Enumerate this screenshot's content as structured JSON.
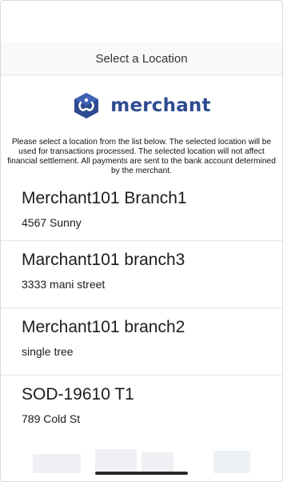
{
  "header": {
    "title": "Select a Location"
  },
  "logo": {
    "text": "merchant",
    "brand_color": "#2f4a8f"
  },
  "instructions": "Please select a location from the list below. The selected location will be used for transactions processed. The selected location will not affect financial settlement. All payments are sent to the bank account determined by the merchant.",
  "locations": [
    {
      "name": "Merchant101 Branch1",
      "address": "4567 Sunny"
    },
    {
      "name": "Marchant101 branch3",
      "address": "3333 mani street"
    },
    {
      "name": "Merchant101 branch2",
      "address": "single tree"
    },
    {
      "name": "SOD-19610 T1",
      "address": "789 Cold St"
    }
  ]
}
